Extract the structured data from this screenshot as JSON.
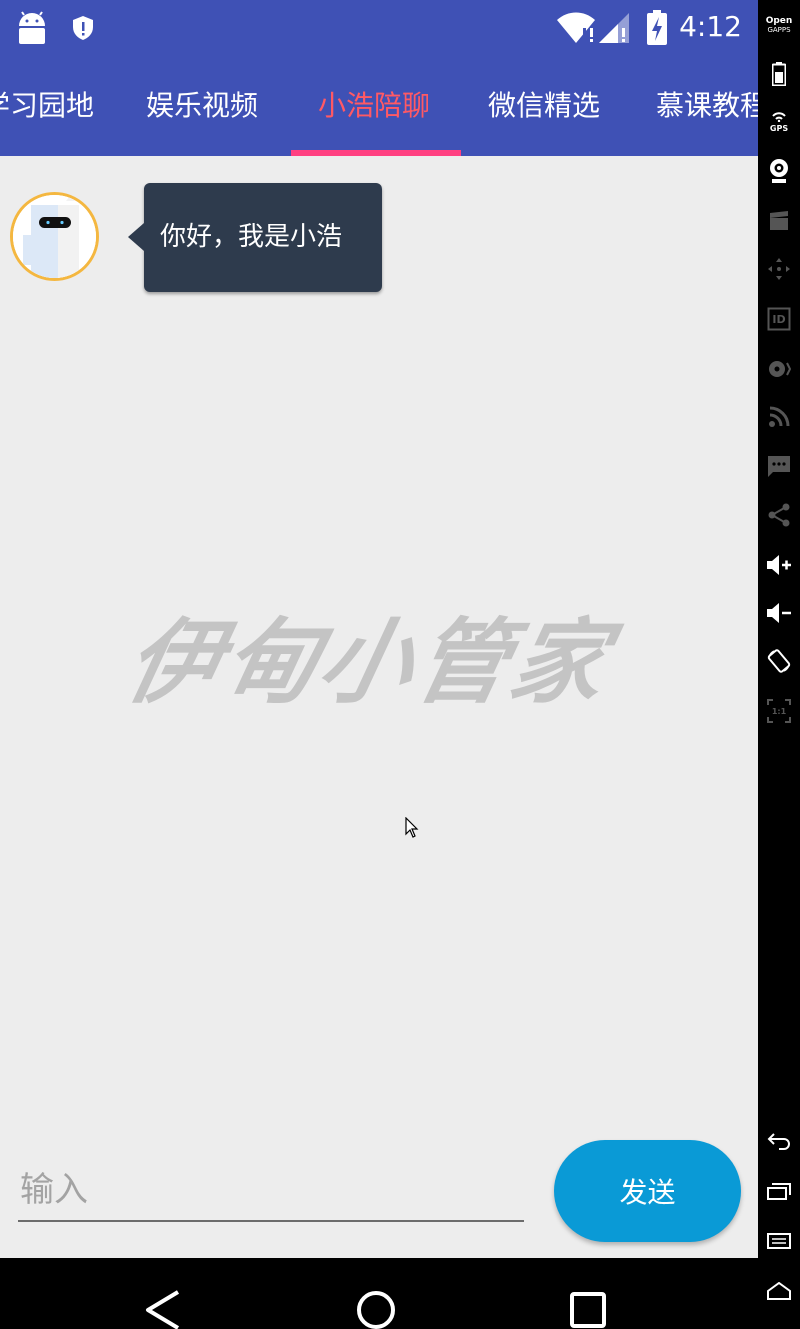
{
  "status_bar": {
    "time": "4:12",
    "icons": [
      "android-icon",
      "shield-icon",
      "wifi-icon",
      "signal-icon",
      "battery-charging-icon"
    ]
  },
  "tabs": [
    {
      "label": "学习园地",
      "active": false
    },
    {
      "label": "娱乐视频",
      "active": false
    },
    {
      "label": "小浩陪聊",
      "active": true
    },
    {
      "label": "微信精选",
      "active": false
    },
    {
      "label": "慕课教程",
      "active": false
    }
  ],
  "colors": {
    "primary": "#3f51b5",
    "active_tab_text": "#ff5964",
    "indicator": "#ff4081",
    "bubble": "#2e3b4d",
    "send_button": "#0a9ad6",
    "background": "#ededed"
  },
  "chat": {
    "messages": [
      {
        "sender": "bot",
        "text": "你好，我是小浩"
      }
    ],
    "watermark": "伊甸小管家"
  },
  "composer": {
    "placeholder": "输入",
    "value": "",
    "send_label": "发送"
  },
  "navigation": [
    "back-icon",
    "home-icon",
    "recents-icon"
  ],
  "emulator_toolbar": {
    "gapps_label_1": "Open",
    "gapps_label_2": "GAPPS",
    "gps_label": "GPS",
    "id_label": "ID",
    "scale_label": "1:1"
  }
}
